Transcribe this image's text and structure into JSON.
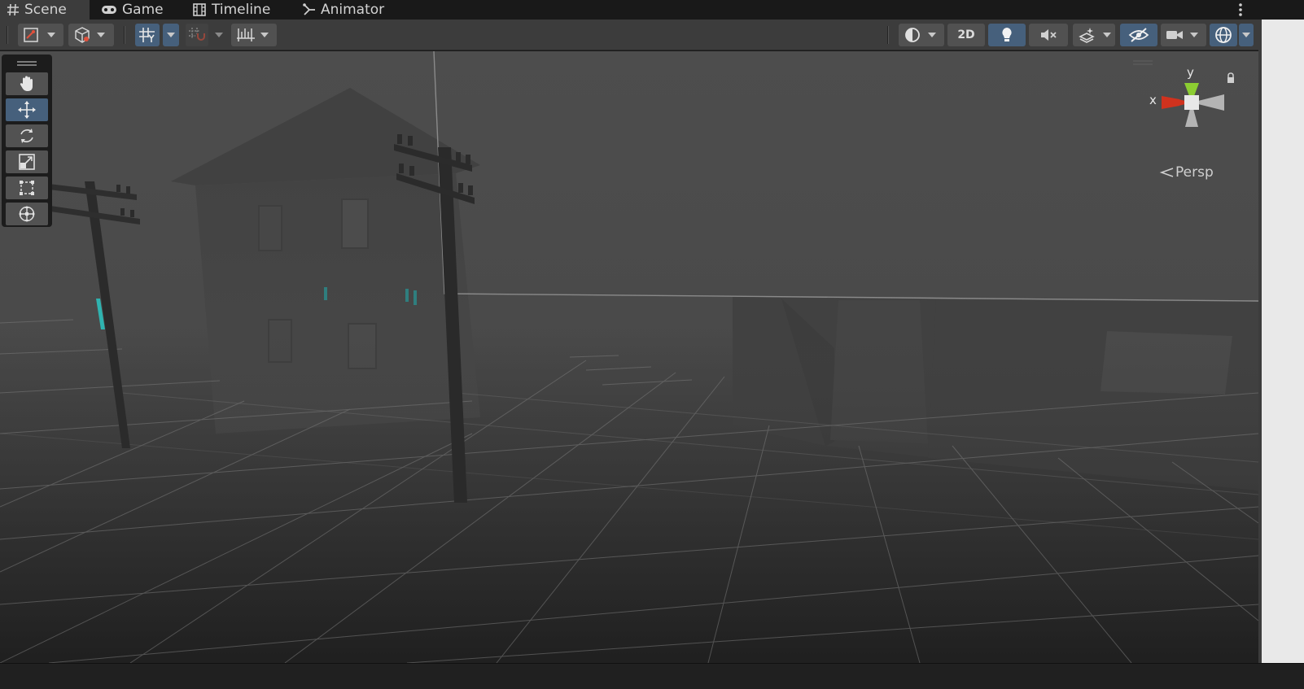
{
  "tabs": [
    {
      "label": "Scene",
      "icon": "hash-icon",
      "active": true
    },
    {
      "label": "Game",
      "icon": "gamepad-icon",
      "active": false
    },
    {
      "label": "Timeline",
      "icon": "film-icon",
      "active": false
    },
    {
      "label": "Animator",
      "icon": "animator-icon",
      "active": false
    }
  ],
  "toolbar": {
    "left_tools": [
      "draw-mode-icon",
      "shading-cube-icon",
      "grid-snap-icon",
      "increment-snap-icon",
      "ruler-icon"
    ],
    "right_tools": [
      "render-sphere-icon",
      "2d-toggle",
      "lighting-bulb-icon",
      "audio-mute-icon",
      "effects-icon",
      "scene-visibility-icon",
      "camera-icon",
      "gizmos-icon"
    ],
    "mode_2d_label": "2D"
  },
  "tool_palette": [
    "hand-tool",
    "move-tool",
    "rotate-tool",
    "scale-tool",
    "rect-tool",
    "transform-tool"
  ],
  "selected_tool": "move-tool",
  "gizmo": {
    "x_label": "x",
    "y_label": "y",
    "projection_label": "Persp"
  },
  "colors": {
    "accent_blue": "#46607c",
    "axis_x": "#d0321e",
    "axis_y": "#8ccd32",
    "viewport_fog": "#4a4a4a"
  }
}
